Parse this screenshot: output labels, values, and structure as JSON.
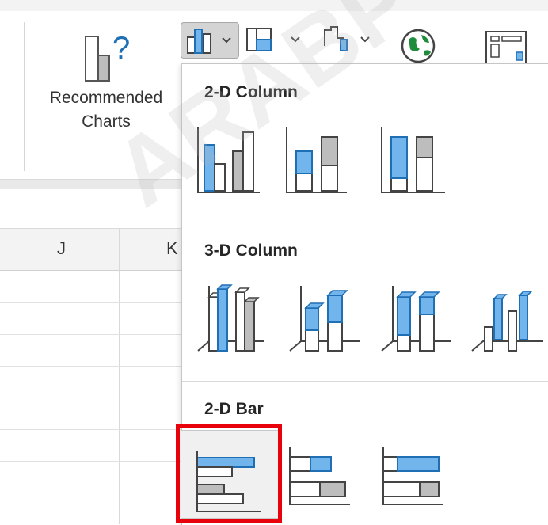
{
  "ribbon": {
    "recommended_charts_line1": "Recommended",
    "recommended_charts_line2": "Charts",
    "recommended_charts_icon": "question-mark-chart-icon",
    "buttons": [
      {
        "name": "column-chart-button",
        "icon": "column-chart-icon",
        "selected": true
      },
      {
        "name": "hierarchy-chart-button",
        "icon": "hierarchy-chart-icon"
      },
      {
        "name": "waterfall-chart-button",
        "icon": "waterfall-chart-icon"
      },
      {
        "name": "maps-button",
        "icon": "globe-icon"
      },
      {
        "name": "pivotchart-button",
        "icon": "pivotchart-icon"
      }
    ]
  },
  "sheet": {
    "columns": [
      "J",
      "K"
    ]
  },
  "dropdown": {
    "sections": [
      {
        "title": "2-D Column",
        "options": [
          "clustered-column",
          "stacked-column",
          "100-stacked-column"
        ]
      },
      {
        "title": "3-D Column",
        "options": [
          "3d-clustered-column",
          "3d-stacked-column",
          "3d-100-stacked-column",
          "3d-column"
        ]
      },
      {
        "title": "2-D Bar",
        "options": [
          "clustered-bar",
          "stacked-bar",
          "100-stacked-bar"
        ]
      }
    ]
  },
  "colors": {
    "accent_blue": "#72b5ec",
    "blue_stroke": "#1f6fb5",
    "gray_fill": "#bdbdbd",
    "highlight_red": "#e8000b"
  },
  "watermark": "ARABP"
}
